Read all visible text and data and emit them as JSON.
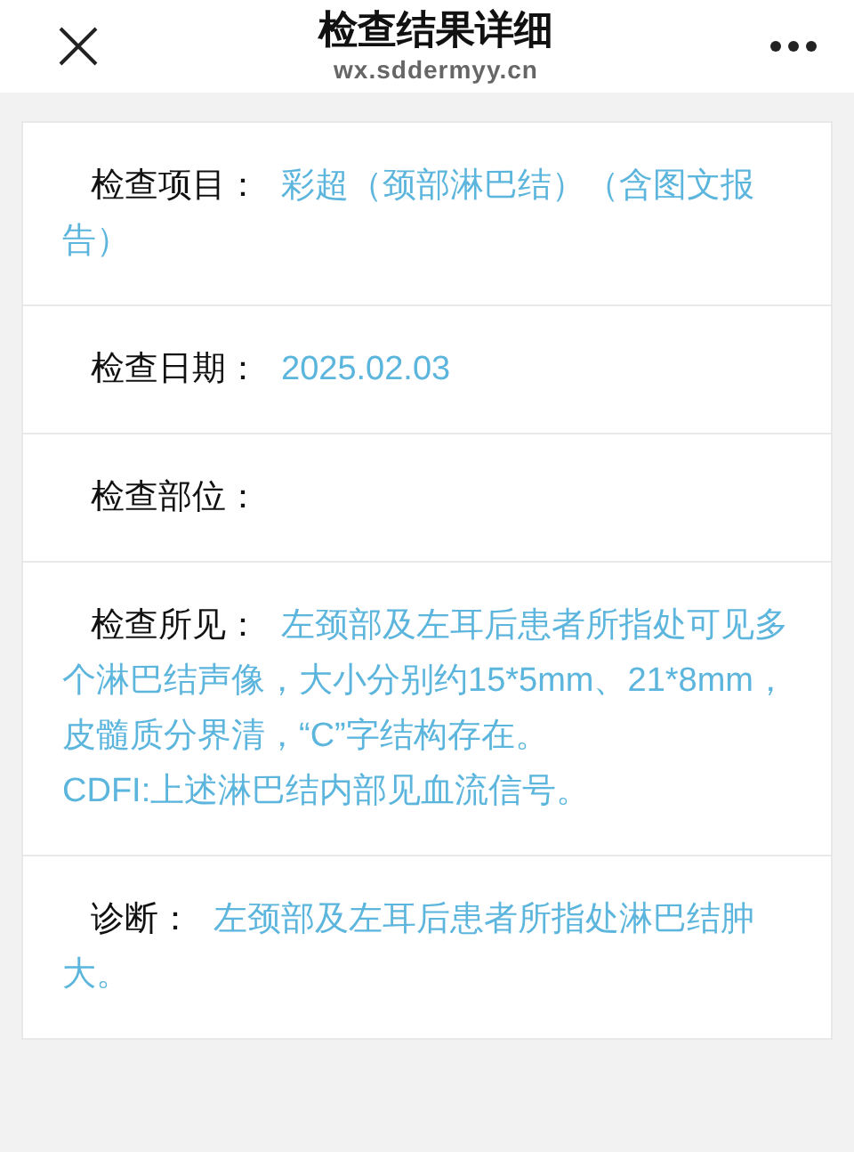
{
  "header": {
    "title": "检查结果详细",
    "domain": "wx.sddermyy.cn"
  },
  "fields": [
    {
      "label": "检查项目：",
      "value": "彩超（颈部淋巴结）（含图文报告）"
    },
    {
      "label": "检查日期：",
      "value": "2025.02.03"
    },
    {
      "label": "检查部位："
    },
    {
      "label": "检查所见：",
      "value": "左颈部及左耳后患者所指处可见多个淋巴结声像，大小分别约15*5mm、21*8mm，皮髓质分界清，“C”字结构存在。\nCDFI:上述淋巴结内部见血流信号。"
    },
    {
      "label": "诊断：",
      "value": "左颈部及左耳后患者所指处淋巴结肿大。"
    }
  ]
}
